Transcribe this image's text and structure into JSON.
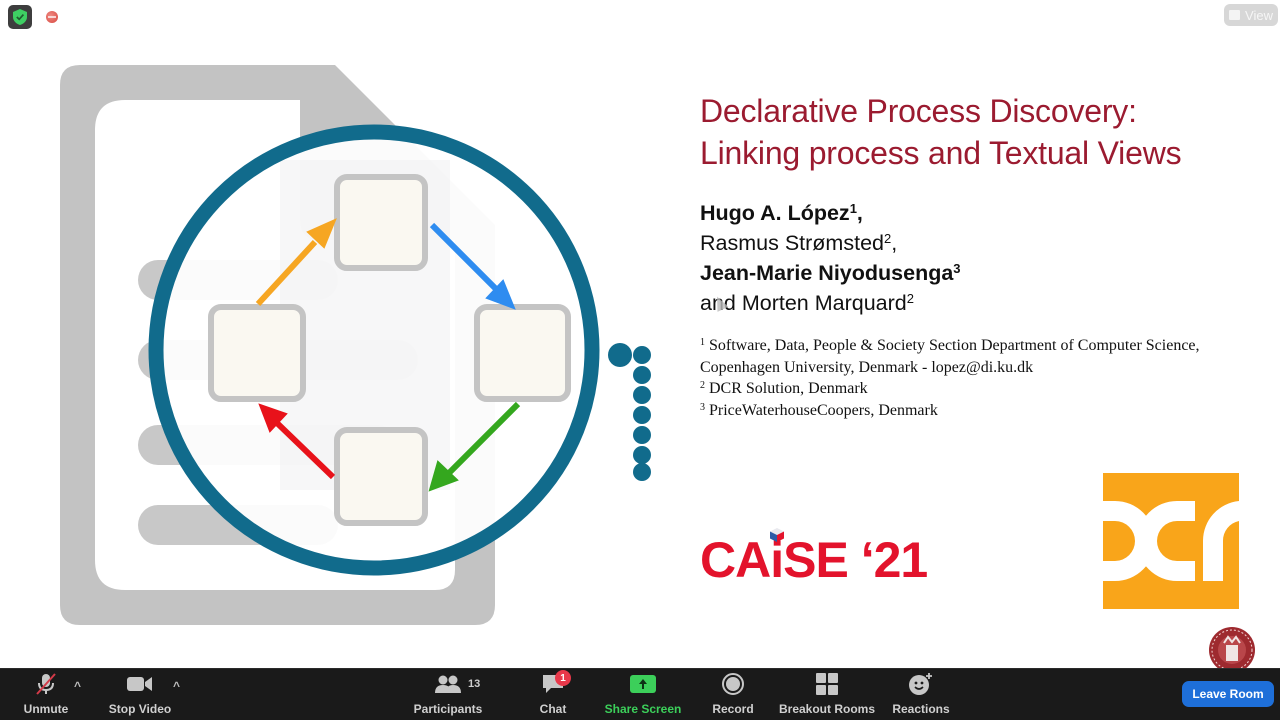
{
  "top_bar": {
    "security_icon": "shield-check-icon",
    "recording_icon": "recording-indicator-icon",
    "view_label": "View"
  },
  "slide": {
    "title_line1": "Declarative Process Discovery:",
    "title_line2": "Linking process and Textual Views",
    "authors": [
      {
        "name": "Hugo A. López",
        "sup": "1",
        "suffix": ",",
        "bold": true
      },
      {
        "name": "Rasmus Strømsted",
        "sup": "2",
        "suffix": ",",
        "bold": false
      },
      {
        "name": "Jean-Marie Niyodusenga",
        "sup": "3",
        "suffix": "",
        "bold": true
      },
      {
        "name": "and Morten Marquard",
        "sup": "2",
        "suffix": "",
        "bold": false
      }
    ],
    "affiliations": [
      {
        "sup": "1",
        "text": "Software, Data, People & Society Section Department of Computer Science,"
      },
      {
        "sup": "",
        "text": "Copenhagen University, Denmark -  lopez@di.ku.dk"
      },
      {
        "sup": "2",
        "text": "DCR Solution, Denmark"
      },
      {
        "sup": "3",
        "text": "PriceWaterhouseCoopers, Denmark"
      }
    ],
    "conference_logo": "CAiSE ‘21",
    "company_logo": "dcr",
    "university_seal": "university-of-copenhagen-seal",
    "colors": {
      "title": "#9b1b30",
      "caise": "#e3132c",
      "dcr": "#f9a51a",
      "magnifier": "#116b8c",
      "arrow_orange": "#f6a623",
      "arrow_blue": "#2e8cf0",
      "arrow_green": "#34a71e",
      "arrow_red": "#e8121a"
    }
  },
  "toolbar": {
    "unmute": "Unmute",
    "stop_video": "Stop Video",
    "participants": "Participants",
    "participants_count": "13",
    "chat": "Chat",
    "chat_badge": "1",
    "share_screen": "Share Screen",
    "record": "Record",
    "breakout_rooms": "Breakout Rooms",
    "reactions": "Reactions",
    "leave_room": "Leave Room",
    "caret": "^"
  }
}
